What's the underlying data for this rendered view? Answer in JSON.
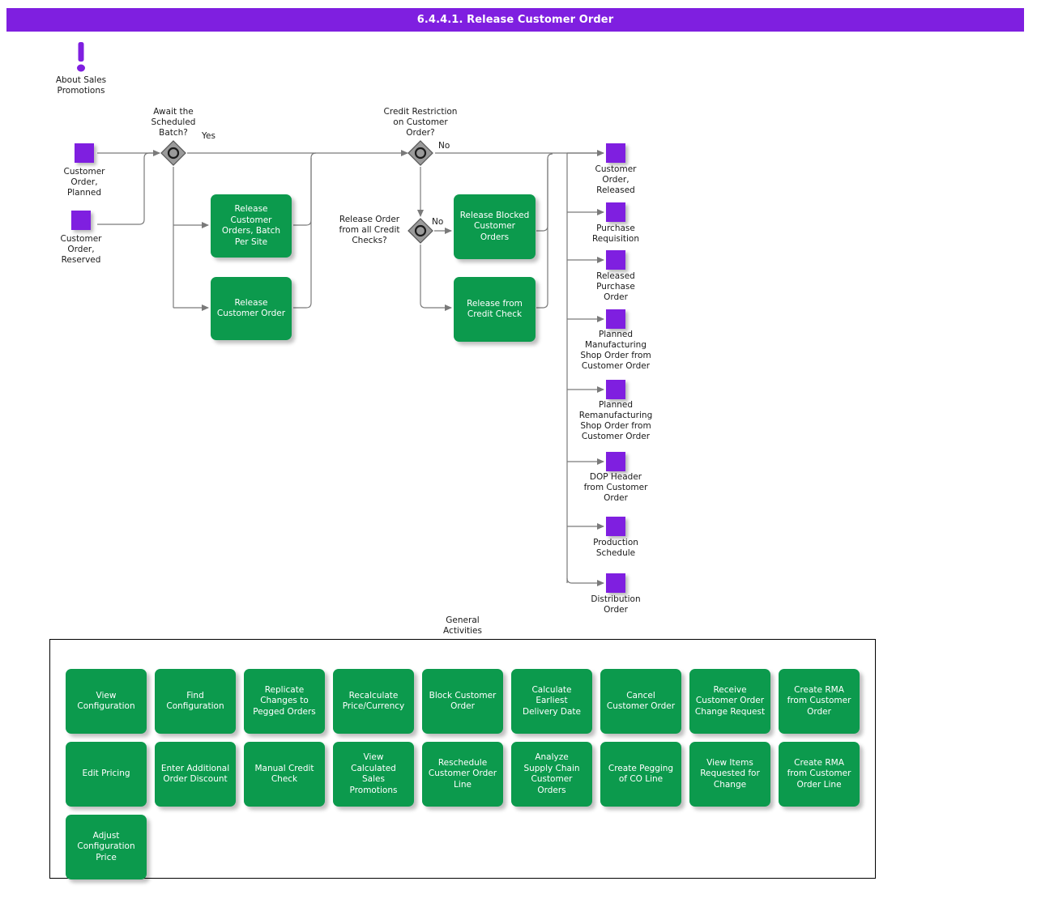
{
  "header": {
    "title": "6.4.4.1. Release Customer Order"
  },
  "annotation": {
    "icon": "exclamation-icon",
    "label": "About Sales\nPromotions"
  },
  "inputs": [
    {
      "label": "Customer\nOrder,\nPlanned",
      "icon": "data-object-square"
    },
    {
      "label": "Customer\nOrder,\nReserved",
      "icon": "data-object-square"
    }
  ],
  "gateways": [
    {
      "question": "Await the\nScheduled\nBatch?",
      "branch_label": "Yes"
    },
    {
      "question": "Credit Restriction\non Customer\nOrder?",
      "branch_label": "No"
    },
    {
      "question": "Release Order\nfrom all Credit\nChecks?",
      "branch_label": "No"
    }
  ],
  "activities": [
    {
      "label": "Release\nCustomer\nOrders, Batch\nPer Site"
    },
    {
      "label": "Release\nCustomer Order"
    },
    {
      "label": "Release Blocked\nCustomer\nOrders"
    },
    {
      "label": "Release from\nCredit Check"
    }
  ],
  "outputs": [
    {
      "label": "Customer\nOrder,\nReleased"
    },
    {
      "label": "Purchase\nRequisition"
    },
    {
      "label": "Released\nPurchase\nOrder"
    },
    {
      "label": "Planned\nManufacturing\nShop Order from\nCustomer Order"
    },
    {
      "label": "Planned\nRemanufacturing\nShop Order from\nCustomer Order"
    },
    {
      "label": "DOP Header\nfrom Customer\nOrder"
    },
    {
      "label": "Production\nSchedule"
    },
    {
      "label": "Distribution\nOrder"
    }
  ],
  "general_activities": {
    "caption": "General\nActivities",
    "items": [
      {
        "label": "View\nConfiguration"
      },
      {
        "label": "Find\nConfiguration"
      },
      {
        "label": "Replicate\nChanges to\nPegged Orders"
      },
      {
        "label": "Recalculate\nPrice/Currency"
      },
      {
        "label": "Block Customer\nOrder"
      },
      {
        "label": "Calculate\nEarliest\nDelivery Date"
      },
      {
        "label": "Cancel\nCustomer Order"
      },
      {
        "label": "Receive\nCustomer Order\nChange Request"
      },
      {
        "label": "Create RMA\nfrom Customer\nOrder"
      },
      {
        "label": "Edit Pricing"
      },
      {
        "label": "Enter Additional\nOrder Discount"
      },
      {
        "label": "Manual Credit\nCheck"
      },
      {
        "label": "View\nCalculated\nSales\nPromotions"
      },
      {
        "label": "Reschedule\nCustomer Order\nLine"
      },
      {
        "label": "Analyze\nSupply Chain\nCustomer\nOrders"
      },
      {
        "label": "Create Pegging\nof CO Line"
      },
      {
        "label": "View Items\nRequested for\nChange"
      },
      {
        "label": "Create RMA\nfrom Customer\nOrder Line"
      },
      {
        "label": "Adjust\nConfiguration\nPrice"
      }
    ]
  },
  "colors": {
    "header_purple": "#7F1FE0",
    "activity_green": "#0C9A4D",
    "data_object_purple": "#7F1FE0",
    "gateway_gray": "#808080",
    "connector_gray": "#7a7a7a",
    "text_dark": "#1a1a1a"
  }
}
